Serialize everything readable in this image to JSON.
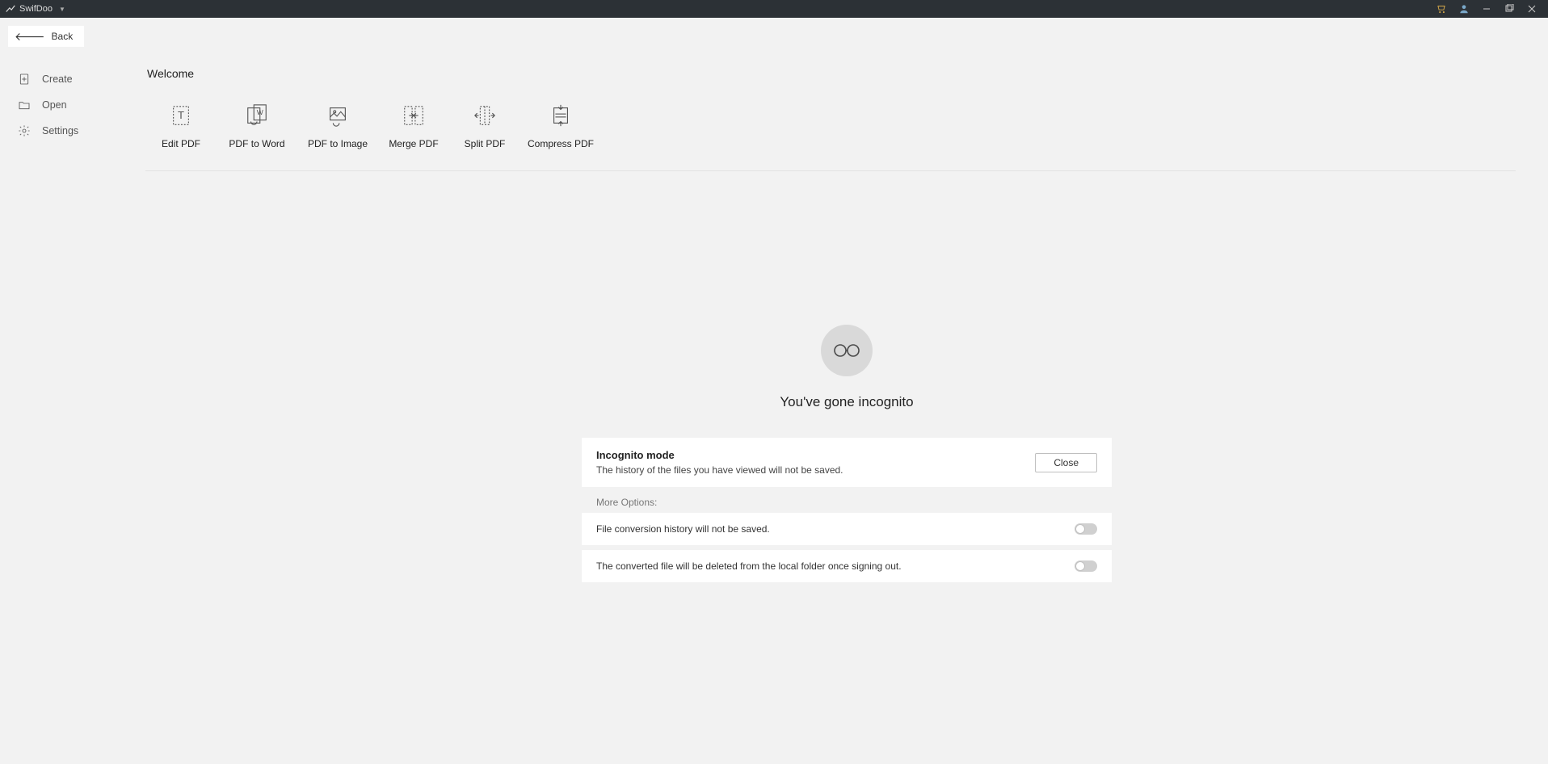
{
  "titlebar": {
    "app_name": "SwifDoo"
  },
  "back": {
    "label": "Back"
  },
  "sidebar": {
    "items": [
      {
        "label": "Create"
      },
      {
        "label": "Open"
      },
      {
        "label": "Settings"
      }
    ]
  },
  "main": {
    "welcome": "Welcome",
    "actions": [
      {
        "label": "Edit PDF"
      },
      {
        "label": "PDF to Word"
      },
      {
        "label": "PDF to Image"
      },
      {
        "label": "Merge PDF"
      },
      {
        "label": "Split PDF"
      },
      {
        "label": "Compress PDF"
      }
    ]
  },
  "incognito": {
    "headline": "You've gone incognito",
    "card_title": "Incognito mode",
    "card_sub": "The history of the files you have viewed will not be saved.",
    "close": "Close",
    "more_options": "More Options:",
    "opt1": "File conversion history will not be saved.",
    "opt2": "The converted file will be deleted from the local folder once signing out."
  }
}
